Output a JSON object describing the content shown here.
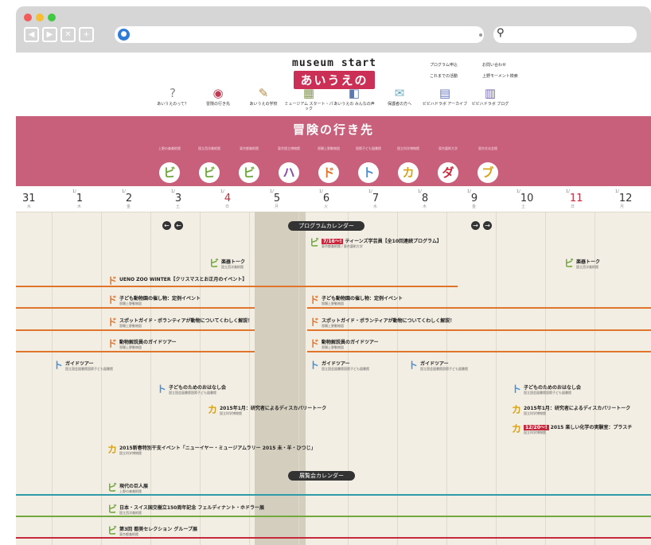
{
  "browser": {
    "search_icon": "magnifier-icon",
    "globe_icon": "globe-icon"
  },
  "colors": {
    "pink": "#c8607c",
    "red": "#cc2f56",
    "orange": "#e2752c",
    "blue": "#4a8fd4",
    "green": "#72a83e",
    "yellow": "#d7a31a",
    "teal": "#2f9aa8",
    "purple": "#8a4ca8"
  },
  "header": {
    "logo_top": "museum start",
    "logo_bottom": "あいうえの",
    "links": [
      "プログラム申込",
      "お問い合わせ",
      "これまでの活動",
      "上野モーメント検索"
    ],
    "nav": [
      {
        "label": "あいうえのって？",
        "icon": "question-icon"
      },
      {
        "label": "冒険の行き先",
        "icon": "compass-icon"
      },
      {
        "label": "あいうえの学校",
        "icon": "pencil-icon"
      },
      {
        "label": "ミュージアム スタート・パック",
        "icon": "pack-icon"
      },
      {
        "label": "あいうえの みんなの声",
        "icon": "voice-icon"
      },
      {
        "label": "保護者の方へ",
        "icon": "envelope-icon"
      },
      {
        "label": "ビビハドラボ アーカイブ",
        "icon": "book-icon"
      },
      {
        "label": "ビビハドラボ ブログ",
        "icon": "blog-icon"
      }
    ]
  },
  "banner": {
    "title": "冒険の行き先",
    "museums": [
      {
        "char": "ビ",
        "sub": "上野の森美術館"
      },
      {
        "char": "ビ",
        "sub": "国立西洋美術館"
      },
      {
        "char": "ビ",
        "sub": "東京都美術館"
      },
      {
        "char": "ハ",
        "sub": "東京国立博物館"
      },
      {
        "char": "ド",
        "sub": "恩賜上野動物園"
      },
      {
        "char": "ト",
        "sub": "国際子ども図書館"
      },
      {
        "char": "カ",
        "sub": "国立科学博物館"
      },
      {
        "char": "ダ",
        "sub": "東京藝術大学"
      },
      {
        "char": "ブ",
        "sub": "東京文化会館"
      }
    ]
  },
  "dates": [
    {
      "m": "",
      "d": "31",
      "w": "水"
    },
    {
      "m": "1/",
      "d": "1",
      "w": "木"
    },
    {
      "m": "1/",
      "d": "2",
      "w": "金"
    },
    {
      "m": "1/",
      "d": "3",
      "w": "土"
    },
    {
      "m": "1/",
      "d": "4",
      "w": "日"
    },
    {
      "m": "1/",
      "d": "5",
      "w": "月"
    },
    {
      "m": "1/",
      "d": "6",
      "w": "火"
    },
    {
      "m": "1/",
      "d": "7",
      "w": "水"
    },
    {
      "m": "1/",
      "d": "8",
      "w": "木"
    },
    {
      "m": "1/",
      "d": "9",
      "w": "金"
    },
    {
      "m": "1/",
      "d": "10",
      "w": "土"
    },
    {
      "m": "1/",
      "d": "11",
      "w": "日"
    },
    {
      "m": "1/",
      "d": "12",
      "w": "月"
    }
  ],
  "program_calendar": "プログラムカレンダー",
  "exhibition_calendar": "展覧会カレンダー",
  "nav_prev": "←",
  "nav_next": "→",
  "events": [
    {
      "char": "ビ",
      "tag": "7/16〜!",
      "title": "ティーンズ学芸員【全10回連続プログラム】",
      "sub": "東京都美術館 / 東京藝術大学",
      "color": "green"
    },
    {
      "char": "ビ",
      "tag": "",
      "title": "楽器トーク",
      "sub": "国立西洋美術館",
      "color": "green"
    },
    {
      "char": "ビ",
      "tag": "",
      "title": "楽器トーク",
      "sub": "国立西洋美術館",
      "color": "green"
    },
    {
      "char": "ド",
      "tag": "",
      "title": "UENO ZOO WINTER【クリスマスとお正月のイベント】",
      "sub": "",
      "color": "orange"
    },
    {
      "char": "ド",
      "tag": "",
      "title": "子ども動物園の催し物：定例イベント",
      "sub": "恩賜上野動物園",
      "color": "orange"
    },
    {
      "char": "ド",
      "tag": "",
      "title": "子ども動物園の催し物：定例イベント",
      "sub": "恩賜上野動物園",
      "color": "orange"
    },
    {
      "char": "ド",
      "tag": "",
      "title": "スポットガイド・ボランティアが動物についてくわしく解説！",
      "sub": "恩賜上野動物園",
      "color": "orange"
    },
    {
      "char": "ド",
      "tag": "",
      "title": "スポットガイド・ボランティアが動物についてくわしく解説！",
      "sub": "恩賜上野動物園",
      "color": "orange"
    },
    {
      "char": "ド",
      "tag": "",
      "title": "動物解説員のガイドツアー",
      "sub": "恩賜上野動物園",
      "color": "orange"
    },
    {
      "char": "ド",
      "tag": "",
      "title": "動物解説員のガイドツアー",
      "sub": "恩賜上野動物園",
      "color": "orange"
    },
    {
      "char": "ト",
      "tag": "",
      "title": "ガイドツアー",
      "sub": "国立国会図書館国際子ども図書館",
      "color": "blue"
    },
    {
      "char": "ト",
      "tag": "",
      "title": "ガイドツアー",
      "sub": "国立国会図書館国際子ども図書館",
      "color": "blue"
    },
    {
      "char": "ト",
      "tag": "",
      "title": "ガイドツアー",
      "sub": "国立国会図書館国際子ども図書館",
      "color": "blue"
    },
    {
      "char": "ト",
      "tag": "",
      "title": "子どものためのおはなし会",
      "sub": "国立国会図書館国際子ども図書館",
      "color": "blue"
    },
    {
      "char": "ト",
      "tag": "",
      "title": "子どものためのおはなし会",
      "sub": "国立国会図書館国際子ども図書館",
      "color": "blue"
    },
    {
      "char": "カ",
      "tag": "",
      "title": "2015年1月：研究者によるディスカバリートーク",
      "sub": "国立科学博物館",
      "color": "yellow"
    },
    {
      "char": "カ",
      "tag": "",
      "title": "2015年1月：研究者によるディスカバリートーク",
      "sub": "国立科学博物館",
      "color": "yellow"
    },
    {
      "char": "カ",
      "tag": "12/20〜!",
      "title": "2015 楽しい化学の実験室：プラスチ",
      "sub": "国立科学博物館",
      "color": "yellow"
    },
    {
      "char": "カ",
      "tag": "",
      "title": "2015新春特別干支イベント「ニューイヤー・ミュージアムラリー 2015 未・羊・ひつじ」",
      "sub": "国立科学博物館",
      "color": "yellow"
    },
    {
      "char": "ビ",
      "tag": "",
      "title": "現代の巨人展",
      "sub": "上野の森美術館",
      "color": "teal"
    },
    {
      "char": "ビ",
      "tag": "",
      "title": "日本・スイス国交樹立150周年記念 フェルディナント・ホドラー展",
      "sub": "国立西洋美術館",
      "color": "green"
    },
    {
      "char": "ビ",
      "tag": "",
      "title": "第3回 都美セレクション グループ展",
      "sub": "東京都美術館",
      "color": "red"
    }
  ]
}
